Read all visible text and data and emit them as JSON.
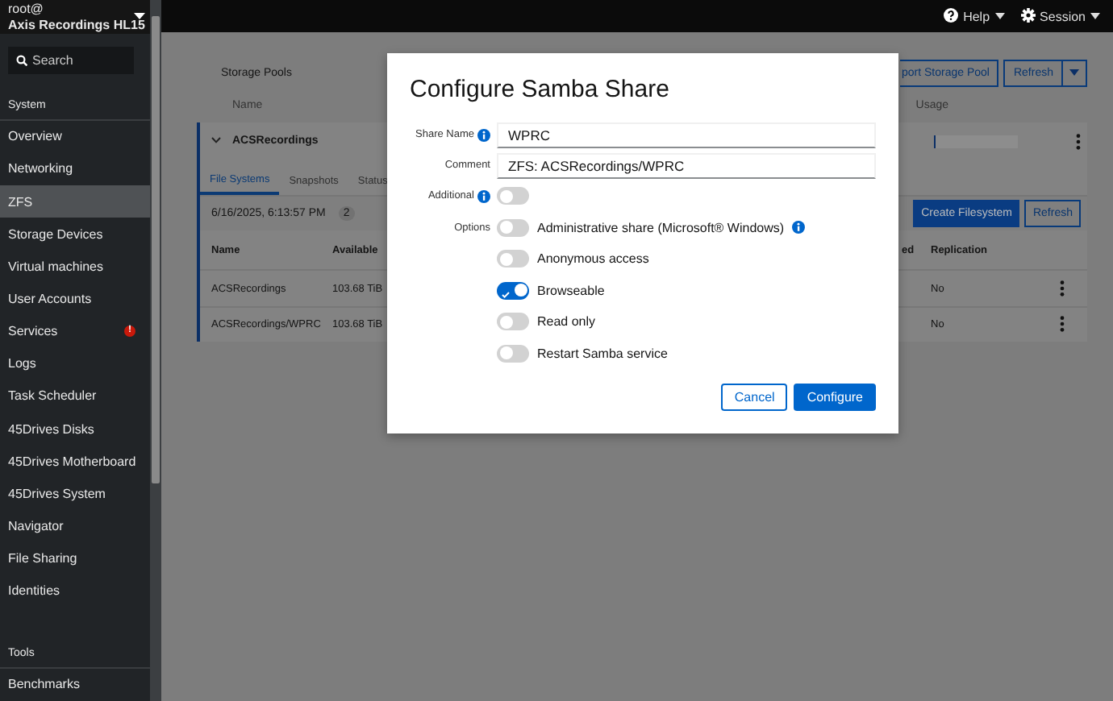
{
  "sidebar": {
    "user": "root@",
    "host": "Axis Recordings HL15",
    "search": {
      "placeholder": "Search"
    },
    "sections": [
      {
        "title": "System",
        "items": [
          {
            "label": "Overview",
            "selected": false
          },
          {
            "label": "Networking",
            "selected": false
          },
          {
            "label": "ZFS",
            "selected": true
          },
          {
            "label": "Storage Devices",
            "selected": false
          },
          {
            "label": "Virtual machines",
            "selected": false
          },
          {
            "label": "User Accounts",
            "selected": false
          },
          {
            "label": "Services",
            "selected": false,
            "badge": "!"
          },
          {
            "label": "Logs",
            "selected": false
          },
          {
            "label": "Task Scheduler",
            "selected": false
          },
          {
            "label": "45Drives Disks",
            "selected": false
          },
          {
            "label": "45Drives Motherboard",
            "selected": false
          },
          {
            "label": "45Drives System",
            "selected": false
          },
          {
            "label": "Navigator",
            "selected": false
          },
          {
            "label": "File Sharing",
            "selected": false
          },
          {
            "label": "Identities",
            "selected": false
          }
        ]
      },
      {
        "title": "Tools",
        "items": [
          {
            "label": "Benchmarks",
            "selected": false
          }
        ]
      }
    ]
  },
  "top_bar": {
    "menus": [
      {
        "label": "Help",
        "kind": "help"
      },
      {
        "label": "Session",
        "kind": "gear"
      }
    ]
  },
  "page": {
    "title": "Storage Pools",
    "buttons": [
      "port Storage Pool",
      "Refresh"
    ],
    "columns": [
      "Name",
      "Usage"
    ],
    "pool": {
      "name": "ACSRecordings",
      "expanded": true,
      "usage": {
        "level": 0.02
      },
      "tabs": [
        {
          "label": "File Systems",
          "selected": true
        },
        {
          "label": "Snapshots",
          "selected": false
        },
        {
          "label": "Status",
          "selected": false
        }
      ],
      "timestamp": "6/16/2025, 6:13:57 PM",
      "count": "2",
      "buttons": [
        "Create Filesystem",
        "Refresh"
      ],
      "table": {
        "columns": [
          "Name",
          "Available",
          "ed",
          "Replication"
        ],
        "rows": [
          [
            "ACSRecordings",
            "103.68 TiB",
            "No"
          ],
          [
            "ACSRecordings/WPRC",
            "103.68 TiB",
            "No"
          ]
        ]
      }
    }
  },
  "dialog": {
    "title": "Configure Samba Share",
    "fields": [
      {
        "label": "Share Name",
        "info": true,
        "value": "WPRC"
      },
      {
        "label": "Comment",
        "info": false,
        "value": "ZFS: ACSRecordings/WPRC"
      }
    ],
    "additional": {
      "label": "Additional",
      "info": true,
      "on": false
    },
    "options": {
      "label": "Options",
      "items": [
        {
          "label": "Administrative share (Microsoft® Windows)",
          "on": false,
          "info": true
        },
        {
          "label": "Anonymous access",
          "on": false,
          "info": false
        },
        {
          "label": "Browseable",
          "on": true,
          "info": false
        },
        {
          "label": "Read only",
          "on": false,
          "info": false
        },
        {
          "label": "Restart Samba service",
          "on": false,
          "info": false
        }
      ]
    },
    "buttons": [
      {
        "label": "Cancel",
        "kind": "secondary"
      },
      {
        "label": "Configure",
        "kind": "primary"
      }
    ]
  }
}
